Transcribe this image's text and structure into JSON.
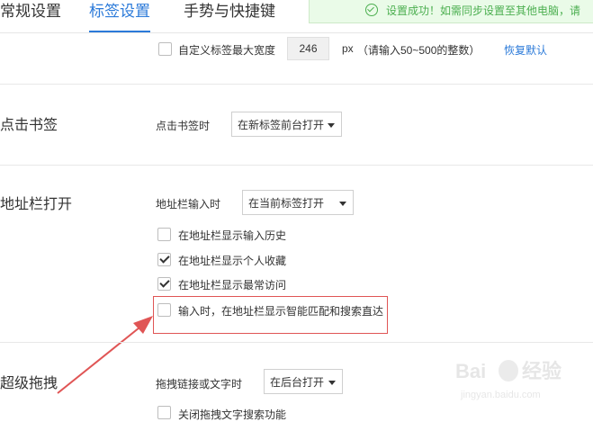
{
  "tabs": [
    {
      "label": "常规设置",
      "active": false
    },
    {
      "label": "标签设置",
      "active": true
    },
    {
      "label": "手势与快捷键",
      "active": false
    }
  ],
  "toast": {
    "message": "设置成功！如需同步设置至其他电脑，请",
    "icon": "check-circle-icon"
  },
  "tab_width": {
    "checkbox_label": "自定义标签最大宽度",
    "value": "246",
    "unit": "px",
    "hint": "（请输入50~500的整数）",
    "reset": "恢复默认"
  },
  "sections": {
    "click_bookmark": {
      "title": "点击书签",
      "label": "点击书签时",
      "select": "在新标签前台打开"
    },
    "address_bar": {
      "title": "地址栏打开",
      "label": "地址栏输入时",
      "select": "在当前标签打开",
      "options": [
        {
          "label": "在地址栏显示输入历史",
          "checked": false
        },
        {
          "label": "在地址栏显示个人收藏",
          "checked": true
        },
        {
          "label": "在地址栏显示最常访问",
          "checked": true
        },
        {
          "label": "输入时，在地址栏显示智能匹配和搜索直达",
          "checked": false
        }
      ]
    },
    "drag": {
      "title": "超级拖拽",
      "label": "拖拽链接或文字时",
      "select": "在后台打开",
      "option": "关闭拖拽文字搜索功能"
    }
  },
  "watermark": {
    "text": "Bai du 经验",
    "sub": "jingyan.baidu.com"
  },
  "colors": {
    "accent": "#2b7ad9",
    "highlight": "#e05555",
    "success": "#4caf50"
  }
}
